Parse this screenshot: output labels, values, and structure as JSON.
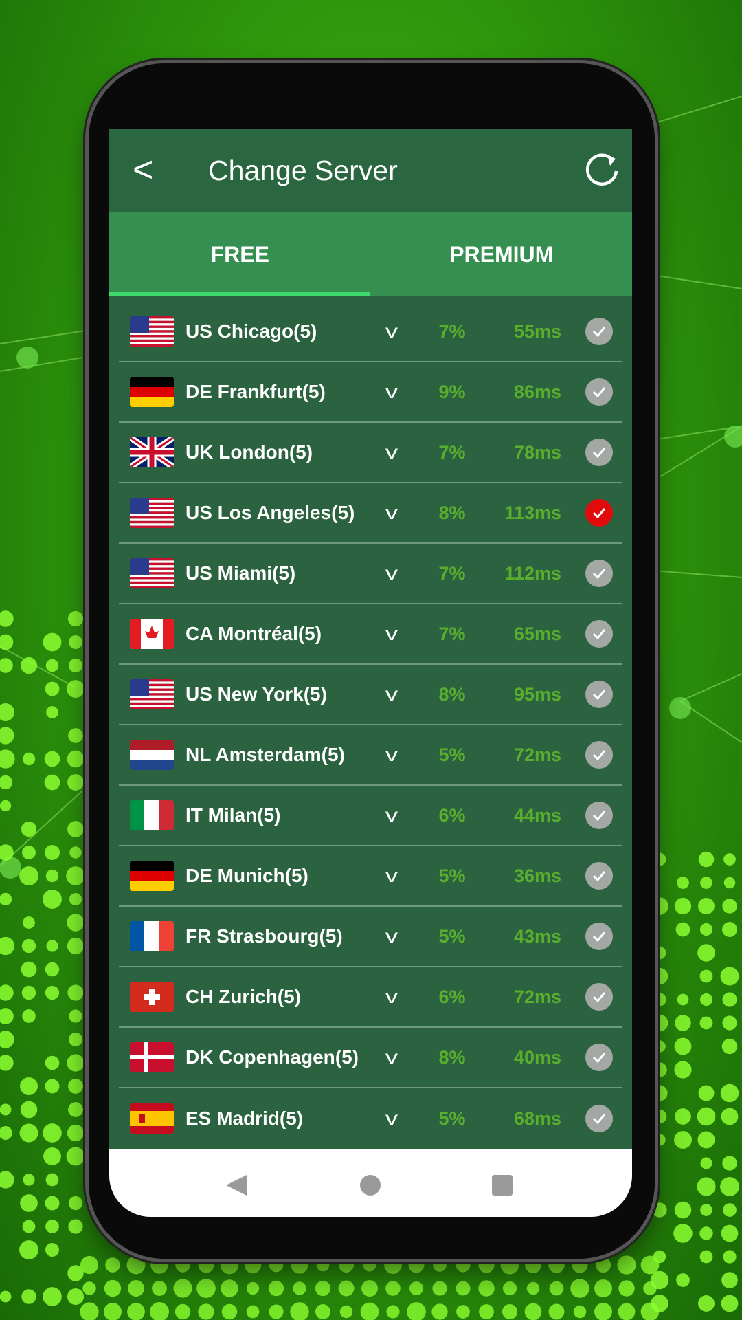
{
  "header": {
    "title": "Change Server",
    "back_icon": "chevron-left-icon",
    "refresh_icon": "refresh-icon"
  },
  "tabs": [
    {
      "label": "FREE",
      "active": true
    },
    {
      "label": "PREMIUM",
      "active": false
    }
  ],
  "colors": {
    "header": "#2a6640",
    "tabs": "#348f50",
    "list": "#2b6340",
    "accent_indicator": "#3ddc6a",
    "value_text": "#5aae2e",
    "selected": "#e20a0a"
  },
  "servers": [
    {
      "flag": "US",
      "name": "US Chicago(5)",
      "load": "7%",
      "ping": "55ms",
      "selected": false
    },
    {
      "flag": "DE",
      "name": "DE Frankfurt(5)",
      "load": "9%",
      "ping": "86ms",
      "selected": false
    },
    {
      "flag": "UK",
      "name": "UK London(5)",
      "load": "7%",
      "ping": "78ms",
      "selected": false
    },
    {
      "flag": "US",
      "name": "US Los Angeles(5)",
      "load": "8%",
      "ping": "113ms",
      "selected": true
    },
    {
      "flag": "US",
      "name": "US Miami(5)",
      "load": "7%",
      "ping": "112ms",
      "selected": false
    },
    {
      "flag": "CA",
      "name": "CA Montréal(5)",
      "load": "7%",
      "ping": "65ms",
      "selected": false
    },
    {
      "flag": "US",
      "name": "US New York(5)",
      "load": "8%",
      "ping": "95ms",
      "selected": false
    },
    {
      "flag": "NL",
      "name": "NL Amsterdam(5)",
      "load": "5%",
      "ping": "72ms",
      "selected": false
    },
    {
      "flag": "IT",
      "name": "IT Milan(5)",
      "load": "6%",
      "ping": "44ms",
      "selected": false
    },
    {
      "flag": "DE",
      "name": "DE Munich(5)",
      "load": "5%",
      "ping": "36ms",
      "selected": false
    },
    {
      "flag": "FR",
      "name": "FR Strasbourg(5)",
      "load": "5%",
      "ping": "43ms",
      "selected": false
    },
    {
      "flag": "CH",
      "name": "CH Zurich(5)",
      "load": "6%",
      "ping": "72ms",
      "selected": false
    },
    {
      "flag": "DK",
      "name": "DK Copenhagen(5)",
      "load": "8%",
      "ping": "40ms",
      "selected": false
    },
    {
      "flag": "ES",
      "name": "ES Madrid(5)",
      "load": "5%",
      "ping": "68ms",
      "selected": false
    }
  ],
  "navbar": {
    "icons": [
      "back-triangle-icon",
      "home-circle-icon",
      "recents-square-icon"
    ]
  }
}
